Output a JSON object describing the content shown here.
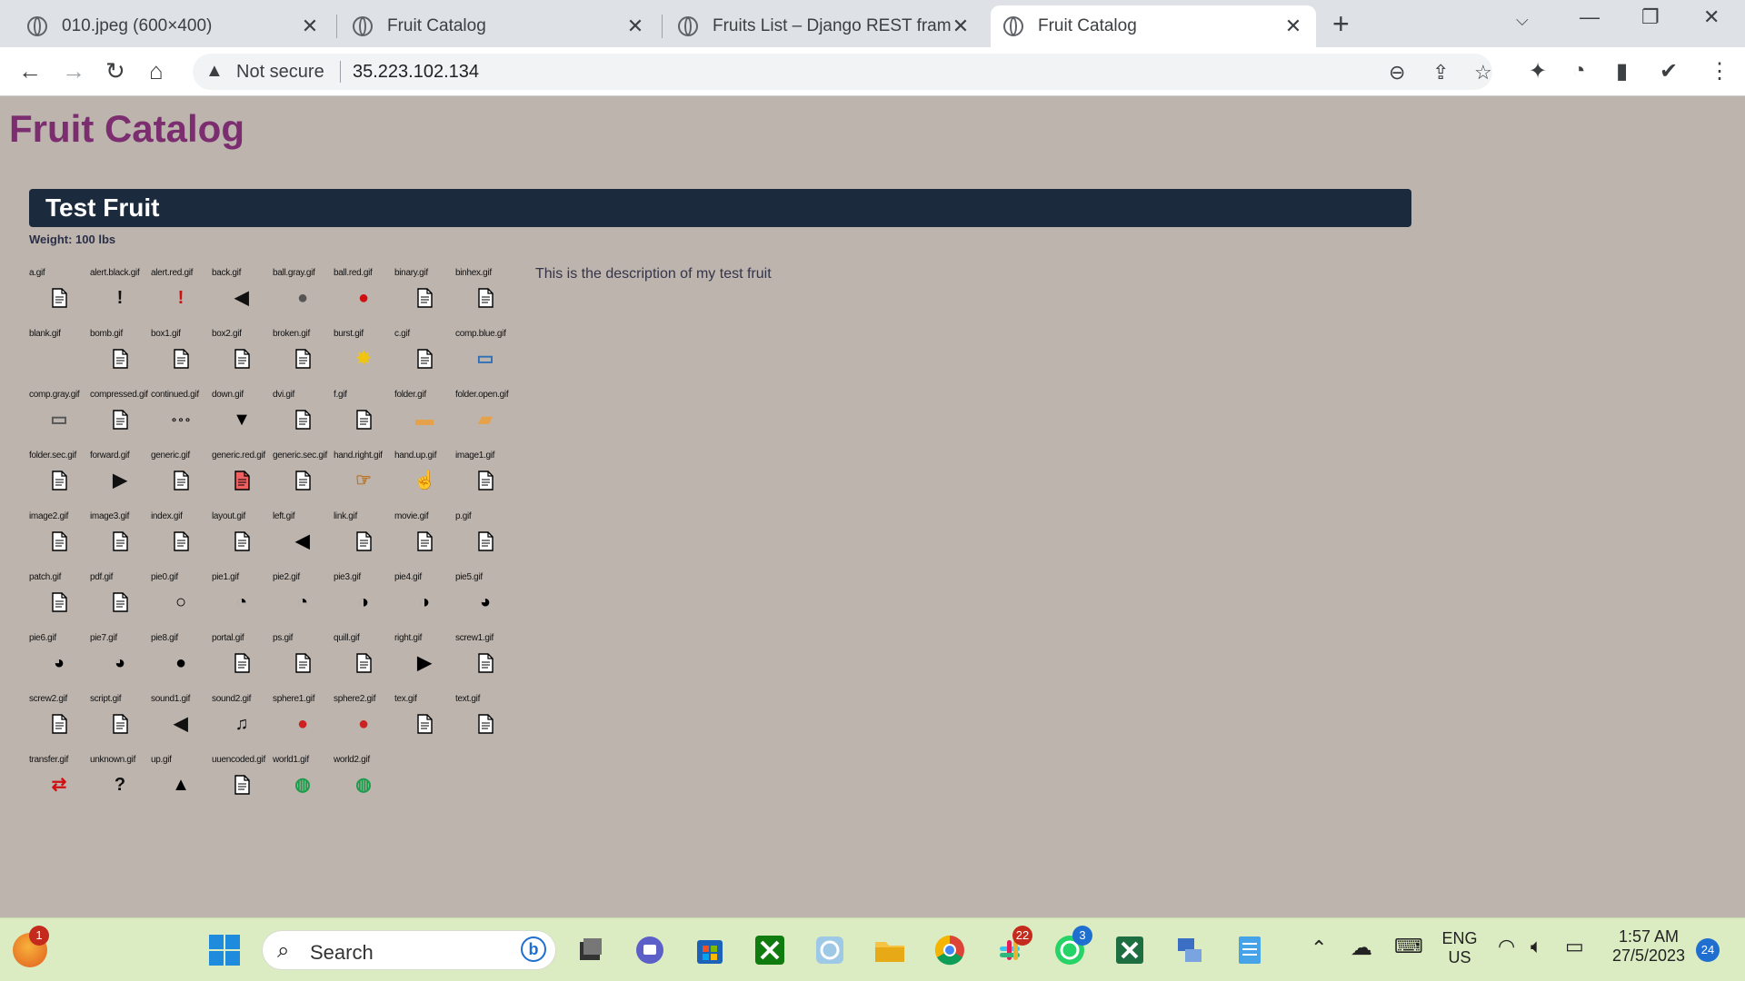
{
  "browser": {
    "tabs": [
      {
        "title": "010.jpeg (600×400)",
        "active": false
      },
      {
        "title": "Fruit Catalog",
        "active": false
      },
      {
        "title": "Fruits List – Django REST framew",
        "active": false
      },
      {
        "title": "Fruit Catalog",
        "active": true
      }
    ],
    "security_label": "Not secure",
    "url": "35.223.102.134"
  },
  "page": {
    "title": "Fruit Catalog",
    "fruit": {
      "name": "Test Fruit",
      "weight": "Weight: 100 lbs",
      "description": "This is the description of my test fruit",
      "icons": [
        "a.gif",
        "alert.black.gif",
        "alert.red.gif",
        "back.gif",
        "ball.gray.gif",
        "ball.red.gif",
        "binary.gif",
        "binhex.gif",
        "blank.gif",
        "bomb.gif",
        "box1.gif",
        "box2.gif",
        "broken.gif",
        "burst.gif",
        "c.gif",
        "comp.blue.gif",
        "comp.gray.gif",
        "compressed.gif",
        "continued.gif",
        "down.gif",
        "dvi.gif",
        "f.gif",
        "folder.gif",
        "folder.open.gif",
        "folder.sec.gif",
        "forward.gif",
        "generic.gif",
        "generic.red.gif",
        "generic.sec.gif",
        "hand.right.gif",
        "hand.up.gif",
        "image1.gif",
        "image2.gif",
        "image3.gif",
        "index.gif",
        "layout.gif",
        "left.gif",
        "link.gif",
        "movie.gif",
        "p.gif",
        "patch.gif",
        "pdf.gif",
        "pie0.gif",
        "pie1.gif",
        "pie2.gif",
        "pie3.gif",
        "pie4.gif",
        "pie5.gif",
        "pie6.gif",
        "pie7.gif",
        "pie8.gif",
        "portal.gif",
        "ps.gif",
        "quill.gif",
        "right.gif",
        "screw1.gif",
        "screw2.gif",
        "script.gif",
        "sound1.gif",
        "sound2.gif",
        "sphere1.gif",
        "sphere2.gif",
        "tex.gif",
        "text.gif",
        "transfer.gif",
        "unknown.gif",
        "up.gif",
        "uuencoded.gif",
        "world1.gif",
        "world2.gif"
      ]
    }
  },
  "taskbar": {
    "search_placeholder": "Search",
    "badges": {
      "browser_profile": "1",
      "slack": "22",
      "whatsapp": "3",
      "notifications": "24"
    },
    "lang_line1": "ENG",
    "lang_line2": "US",
    "time": "1:57 AM",
    "date": "27/5/2023"
  },
  "colors": {
    "page_bg": "#bdb4ae",
    "title": "#7b2d6f",
    "banner": "#1b2a3d",
    "taskbar": "#dcecc2"
  }
}
